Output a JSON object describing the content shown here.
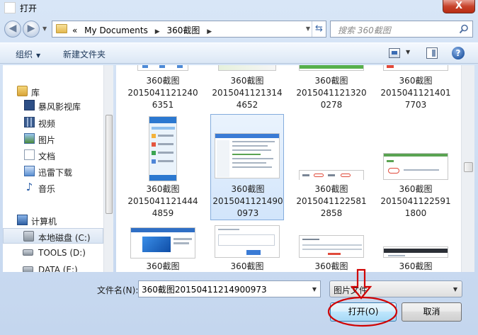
{
  "titlebar": {
    "title": "打开",
    "close_glyph": "X"
  },
  "address": {
    "overflow": "«",
    "breadcrumbs": [
      "My Documents",
      "360截图"
    ],
    "search_placeholder": "搜索 360截图"
  },
  "toolbar": {
    "organize": "组织",
    "new_folder": "新建文件夹"
  },
  "nav": {
    "items": [
      {
        "label": "库",
        "icon": "library-icon"
      },
      {
        "label": "暴风影视库",
        "icon": "video-library-icon"
      },
      {
        "label": "视频",
        "icon": "video-icon"
      },
      {
        "label": "图片",
        "icon": "pictures-icon"
      },
      {
        "label": "文档",
        "icon": "documents-icon"
      },
      {
        "label": "迅雷下载",
        "icon": "downloads-icon"
      },
      {
        "label": "音乐",
        "icon": "music-icon"
      },
      {
        "label": "计算机",
        "icon": "computer-icon"
      },
      {
        "label": "本地磁盘 (C:)",
        "icon": "disk-icon"
      },
      {
        "label": "TOOLS (D:)",
        "icon": "disk-icon"
      },
      {
        "label": "DATA (E:)",
        "icon": "disk-icon"
      }
    ]
  },
  "files": {
    "row1": [
      {
        "l1": "360截图",
        "l2": "2015041121240",
        "l3": "6351"
      },
      {
        "l1": "360截图",
        "l2": "2015041121314",
        "l3": "4652"
      },
      {
        "l1": "360截图",
        "l2": "2015041121320",
        "l3": "0278"
      },
      {
        "l1": "360截图",
        "l2": "2015041121401",
        "l3": "7703"
      }
    ],
    "row2": [
      {
        "l1": "360截图",
        "l2": "2015041121444",
        "l3": "4859"
      },
      {
        "l1": "360截图",
        "l2": "2015041121490",
        "l3": "0973"
      },
      {
        "l1": "360截图",
        "l2": "2015041122581",
        "l3": "2858"
      },
      {
        "l1": "360截图",
        "l2": "2015041122591",
        "l3": "1800"
      }
    ],
    "row3": [
      {
        "l1": "360截图"
      },
      {
        "l1": "360截图"
      },
      {
        "l1": "360截图"
      },
      {
        "l1": "360截图"
      }
    ]
  },
  "bottom": {
    "filename_label": "文件名(N):",
    "filename_value": "360截图20150411214900973",
    "filetype": "图片文件",
    "open_button": "打开(O)",
    "cancel_button": "取消"
  },
  "colors": {
    "accent": "#3c7fb1",
    "annotation": "#d00000",
    "selection": "#cce4fb"
  }
}
